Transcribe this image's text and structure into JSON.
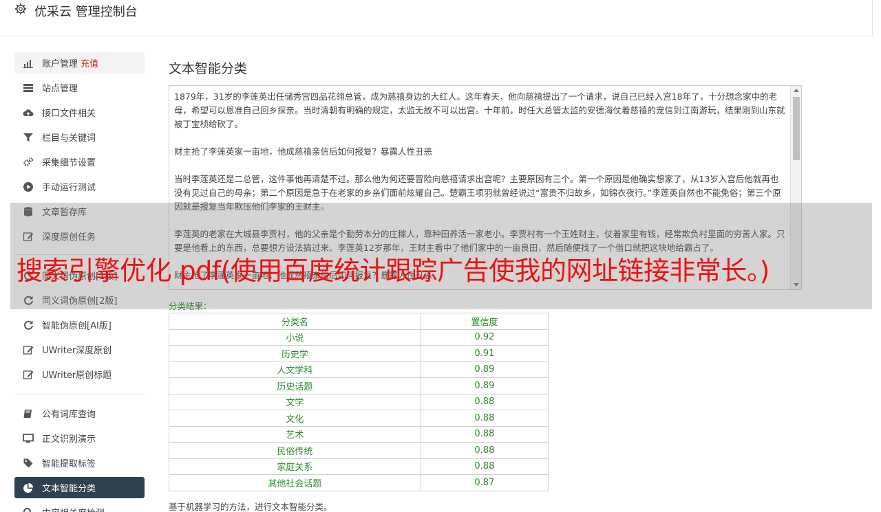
{
  "app": {
    "title": "优采云 管理控制台"
  },
  "sidebar": {
    "items": [
      {
        "label": "账户管理",
        "extra": "充值",
        "icon": "bar-chart-icon"
      },
      {
        "label": "站点管理",
        "icon": "server-icon"
      },
      {
        "label": "接口文件相关",
        "icon": "cloud-upload-icon"
      },
      {
        "label": "栏目与关键词",
        "icon": "filter-icon"
      },
      {
        "label": "采集细节设置",
        "icon": "gears-icon"
      },
      {
        "label": "手动运行测试",
        "icon": "play-circle-icon"
      },
      {
        "label": "文章暂存库",
        "icon": "database-icon"
      },
      {
        "label": "深度原创任务",
        "icon": "edit-icon"
      },
      {
        "label": "同义词伪原创[1版]",
        "icon": "refresh-icon"
      },
      {
        "label": "同义词伪原创[2版]",
        "icon": "refresh-icon"
      },
      {
        "label": "智能伪原创[AI版]",
        "icon": "refresh-icon"
      },
      {
        "label": "UWriter深度原创",
        "icon": "edit-icon"
      },
      {
        "label": "UWriter原创标题",
        "icon": "edit-icon"
      },
      {
        "label": "公有词库查询",
        "icon": "book-icon"
      },
      {
        "label": "正文识别演示",
        "icon": "monitor-icon"
      },
      {
        "label": "智能提取标签",
        "icon": "tag-icon"
      },
      {
        "label": "文本智能分类",
        "icon": "pie-chart-icon"
      },
      {
        "label": "内容相关度检测",
        "icon": "search-icon"
      }
    ]
  },
  "main": {
    "title": "文本智能分类",
    "text_content": [
      "1879年，31岁的李莲英出任储秀宫四品花翎总管，成为慈禧身边的大红人。这年春天，他向慈禧提出了一个请求，说自己已经入宫18年了，十分想念家中的老母，希望可以恩准自己回乡探亲。当时清朝有明确的规定，太监无故不可以出宫。十年前，时任大总管太监的安德海仗着慈禧的宠信到江南游玩，结果刚到山东就被丁宝桢给砍了。",
      "财主抢了李莲英家一亩地，他成慈禧亲信后如何报复？暴露人性丑恶",
      "当时李莲英还是二总管，这件事他再清楚不过。那么他为何还要冒险向慈禧请求出宫呢？主要原因有三个。第一个原因是他确实想家了，从13岁入宫后他就再也没有见过自己的母亲；第二个原因是急于在老家的乡亲们面前炫耀自己。楚霸王项羽就曾经说过“富贵不归故乡，如锦衣夜行。”李莲英自然也不能免俗；第三个原因就是报复当年欺压他们李家的王财主。",
      "李莲英的老家在大城县李贾村，他的父亲是个勤劳本分的庄稼人，靠种田养活一家老小。李贾村有一个王姓财主，仗着家里有钱，经常欺负村里面的穷苦人家。只要是他看上的东西，总要想方设法搞过来。李莲英12岁那年，王财主看中了他们家中的一亩良田，然后随便找了一个借口就把这块地给霸占了。",
      "财主抢了李莲英家一亩地，他成慈禧亲信后如何报复？暴露人性丑恶"
    ],
    "result_label": "分类结果：",
    "table": {
      "headers": [
        "分类名",
        "置信度"
      ],
      "rows": [
        [
          "小说",
          "0.92"
        ],
        [
          "历史学",
          "0.91"
        ],
        [
          "人文学科",
          "0.89"
        ],
        [
          "历史话题",
          "0.89"
        ],
        [
          "文学",
          "0.88"
        ],
        [
          "文化",
          "0.88"
        ],
        [
          "艺术",
          "0.88"
        ],
        [
          "民俗传统",
          "0.88"
        ],
        [
          "家庭关系",
          "0.88"
        ],
        [
          "其他社会话题",
          "0.87"
        ]
      ]
    },
    "footnote": "基于机器学习的方法，进行文本智能分类。"
  },
  "overlay": {
    "text": "搜索引擎优化 pdf(使用百度统计跟踪广告使我的网址链接非常长。)"
  },
  "colors": {
    "active_nav_bg": "#2f4050",
    "result_green": "#2a8a2a",
    "recharge_red": "#d9201a",
    "overlay_red": "#ee1111"
  }
}
